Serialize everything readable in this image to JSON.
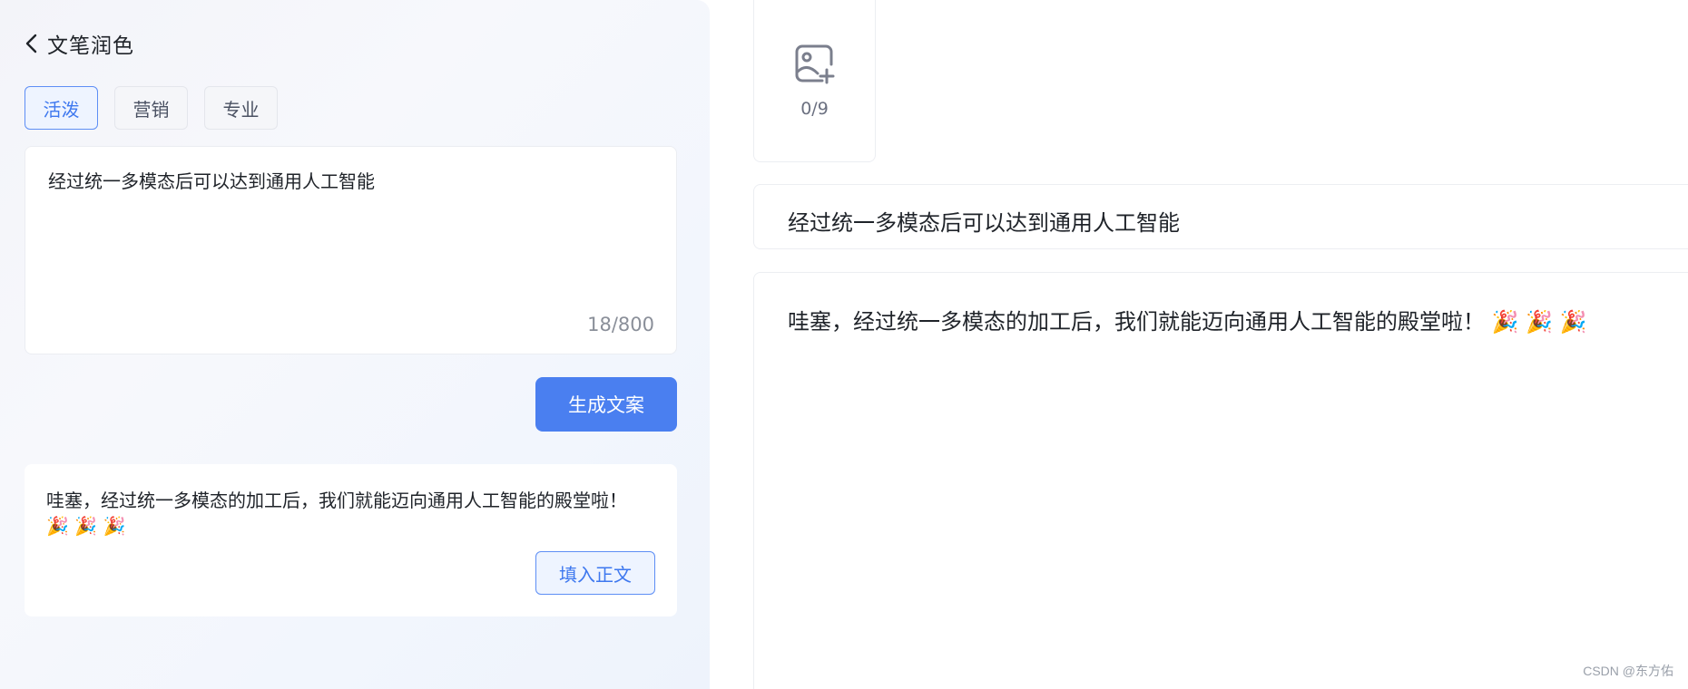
{
  "header": {
    "title": "文笔润色"
  },
  "tabs": [
    {
      "label": "活泼",
      "active": true
    },
    {
      "label": "营销",
      "active": false
    },
    {
      "label": "专业",
      "active": false
    }
  ],
  "input": {
    "value": "经过统一多模态后可以达到通用人工智能",
    "char_count": "18/800"
  },
  "generate_button": "生成文案",
  "result": {
    "text": "哇塞，经过统一多模态的加工后，我们就能迈向通用人工智能的殿堂啦！ 🎉 🎉 🎉",
    "fill_button": "填入正文"
  },
  "upload": {
    "count": "0/9",
    "icon": "add-image-icon"
  },
  "editor": {
    "title": "经过统一多模态后可以达到通用人工智能",
    "body": "哇塞，经过统一多模态的加工后，我们就能迈向通用人工智能的殿堂啦！ 🎉 🎉 🎉"
  },
  "watermark": "CSDN @东方佑",
  "colors": {
    "accent": "#4a7ff0",
    "active_tab_border": "#5d8ef5",
    "active_tab_bg": "#eef4ff"
  }
}
